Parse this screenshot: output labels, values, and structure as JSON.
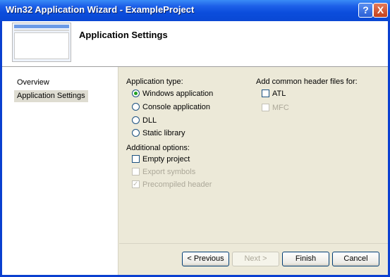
{
  "window": {
    "title": "Win32 Application Wizard - ExampleProject"
  },
  "header": {
    "title": "Application Settings"
  },
  "nav": {
    "items": [
      "Overview",
      "Application Settings"
    ]
  },
  "app_type": {
    "label": "Application type:",
    "options": [
      "Windows application",
      "Console application",
      "DLL",
      "Static library"
    ],
    "selected": "Windows application"
  },
  "additional": {
    "label": "Additional options:",
    "options": [
      {
        "label": "Empty project",
        "checked": false,
        "enabled": true
      },
      {
        "label": "Export symbols",
        "checked": false,
        "enabled": false
      },
      {
        "label": "Precompiled header",
        "checked": true,
        "enabled": false
      }
    ]
  },
  "headers": {
    "label": "Add common header files for:",
    "options": [
      {
        "label": "ATL",
        "checked": false,
        "enabled": true
      },
      {
        "label": "MFC",
        "checked": false,
        "enabled": false
      }
    ]
  },
  "buttons": {
    "previous": "< Previous",
    "next": "Next >",
    "finish": "Finish",
    "cancel": "Cancel"
  },
  "titlebar_buttons": {
    "help": "?",
    "close": "X"
  }
}
